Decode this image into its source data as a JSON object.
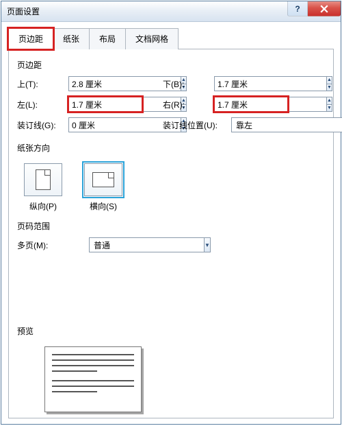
{
  "window": {
    "title": "页面设置",
    "help_symbol": "?"
  },
  "tabs": {
    "margins": "页边距",
    "paper": "纸张",
    "layout": "布局",
    "grid": "文档网格"
  },
  "margins": {
    "section_label": "页边距",
    "top_label": "上(T):",
    "top_value": "2.8 厘米",
    "bottom_label": "下(B):",
    "bottom_value": "1.7 厘米",
    "left_label": "左(L):",
    "left_value": "1.7 厘米",
    "right_label": "右(R):",
    "right_value": "1.7 厘米",
    "gutter_label": "装订线(G):",
    "gutter_value": "0 厘米",
    "gutter_pos_label": "装订线位置(U):",
    "gutter_pos_value": "靠左"
  },
  "orientation": {
    "section_label": "纸张方向",
    "portrait_label": "纵向(P)",
    "landscape_label": "横向(S)"
  },
  "pages": {
    "section_label": "页码范围",
    "multi_label": "多页(M):",
    "multi_value": "普通"
  },
  "preview": {
    "section_label": "预览"
  }
}
